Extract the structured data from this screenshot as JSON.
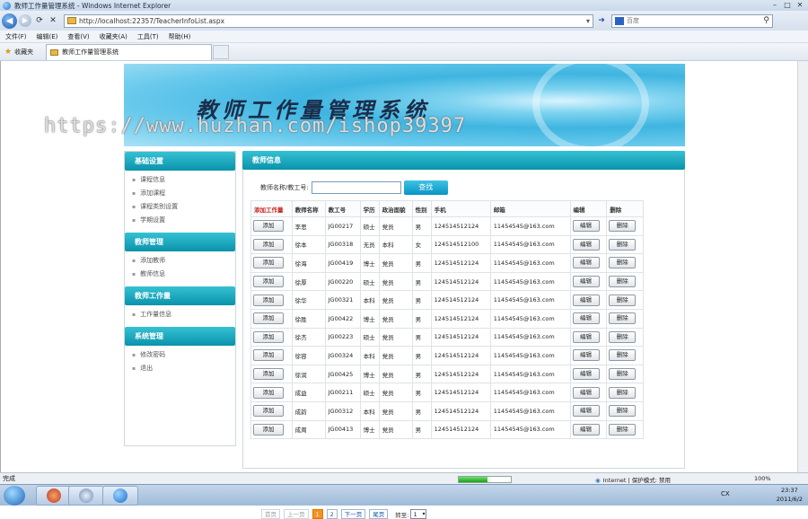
{
  "window": {
    "title": "教师工作量管理系统 - Windows Internet Explorer"
  },
  "address": {
    "url": "http://localhost:22357/TeacherInfoList.aspx",
    "search_placeholder": "百度"
  },
  "menu": [
    "文件(F)",
    "编辑(E)",
    "查看(V)",
    "收藏夹(A)",
    "工具(T)",
    "帮助(H)"
  ],
  "favorites": {
    "label": "收藏夹",
    "tab_title": "教师工作量管理系统"
  },
  "banner": {
    "title": "教师工作量管理系统",
    "watermark": "https://www.huzhan.com/ishop39397"
  },
  "sidebar": [
    {
      "title": "基础设置",
      "items": [
        "课程信息",
        "添加课程",
        "课程类别设置",
        "学期设置"
      ]
    },
    {
      "title": "教师管理",
      "items": [
        "添加教师",
        "教师信息"
      ]
    },
    {
      "title": "教师工作量",
      "items": [
        "工作量信息"
      ]
    },
    {
      "title": "系统管理",
      "items": [
        "修改密码",
        "退出"
      ]
    }
  ],
  "panel": {
    "title": "教师信息",
    "search_label": "教师名称/教工号:",
    "search_value": "",
    "search_button": "查找"
  },
  "table": {
    "headers": [
      "添加工作量",
      "教师名称",
      "教工号",
      "学历",
      "政治面貌",
      "性别",
      "手机",
      "邮箱",
      "编辑",
      "删除"
    ],
    "add_label": "添加",
    "edit_label": "编辑",
    "delete_label": "删除",
    "rows": [
      [
        "李思",
        "JG00217",
        "硕士",
        "党员",
        "男",
        "124514512124",
        "11454545@163.com"
      ],
      [
        "徐本",
        "JG00318",
        "无员",
        "本科",
        "女",
        "124514512100",
        "11454545@163.com"
      ],
      [
        "徐海",
        "JG00419",
        "博士",
        "党员",
        "男",
        "124514512124",
        "11454545@163.com"
      ],
      [
        "徐厚",
        "JG00220",
        "硕士",
        "党员",
        "男",
        "124514512124",
        "11454545@163.com"
      ],
      [
        "徐华",
        "JG00321",
        "本科",
        "党员",
        "男",
        "124514512124",
        "11454545@163.com"
      ],
      [
        "徐胜",
        "JG00422",
        "博士",
        "党员",
        "男",
        "124514512124",
        "11454545@163.com"
      ],
      [
        "徐杰",
        "JG00223",
        "硕士",
        "党员",
        "男",
        "124514512124",
        "11454545@163.com"
      ],
      [
        "徐容",
        "JG00324",
        "本科",
        "党员",
        "男",
        "124514512124",
        "11454545@163.com"
      ],
      [
        "徐润",
        "JG00425",
        "博士",
        "党员",
        "男",
        "124514512124",
        "11454545@163.com"
      ],
      [
        "成益",
        "JG00211",
        "硕士",
        "党员",
        "男",
        "124514512124",
        "11454545@163.com"
      ],
      [
        "成韵",
        "JG00312",
        "本科",
        "党员",
        "男",
        "124514512124",
        "11454545@163.com"
      ],
      [
        "成周",
        "JG00413",
        "博士",
        "党员",
        "男",
        "124514512124",
        "11454545@163.com"
      ]
    ]
  },
  "pager": {
    "first": "首页",
    "prev": "上一页",
    "pages": [
      "1",
      "2"
    ],
    "current": "1",
    "next": "下一页",
    "last": "尾页",
    "goto_label": "转至:",
    "goto_value": "1"
  },
  "status": {
    "text": "完成",
    "progress": 0.55,
    "zone": "Internet | 保护模式: 禁用",
    "zoom": "100%"
  },
  "taskbar": {
    "lang": "CX",
    "time": "23:37",
    "date": "2011/6/2"
  }
}
